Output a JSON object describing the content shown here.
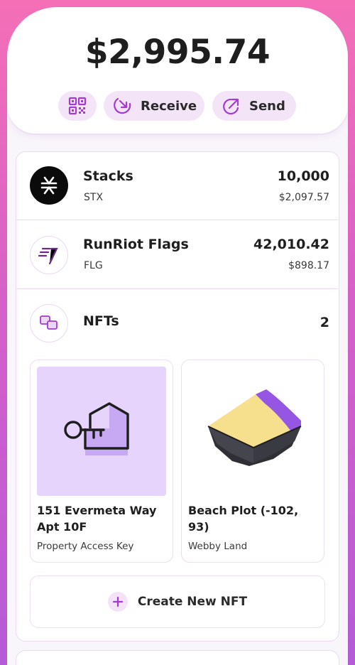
{
  "balance": "$2,995.74",
  "actions": {
    "receive_label": "Receive",
    "send_label": "Send",
    "qr_icon": "qr-code-icon",
    "receive_icon": "arrow-down-left-icon",
    "send_icon": "arrow-up-right-icon"
  },
  "tokens": [
    {
      "name": "Stacks",
      "symbol": "STX",
      "amount": "10,000",
      "fiat": "$2,097.57",
      "icon": "stacks-logo-icon"
    },
    {
      "name": "RunRiot Flags",
      "symbol": "FLG",
      "amount": "42,010.42",
      "fiat": "$898.17",
      "icon": "runriot-logo-icon"
    }
  ],
  "nfts": {
    "label": "NFTs",
    "count": "2",
    "icon": "nfts-icon",
    "items": [
      {
        "title": "151 Evermeta Way Apt 10F",
        "subtitle": "Property Access Key",
        "image": "house-key-icon"
      },
      {
        "title": "Beach Plot (-102, 93)",
        "subtitle": "Webby Land",
        "image": "land-plot-image"
      }
    ],
    "create_label": "Create New NFT"
  },
  "colors": {
    "accent": "#a23bd1",
    "accent_light": "#f3e4f8",
    "frame_top": "#f46fb6",
    "frame_bottom": "#b55bd6"
  }
}
